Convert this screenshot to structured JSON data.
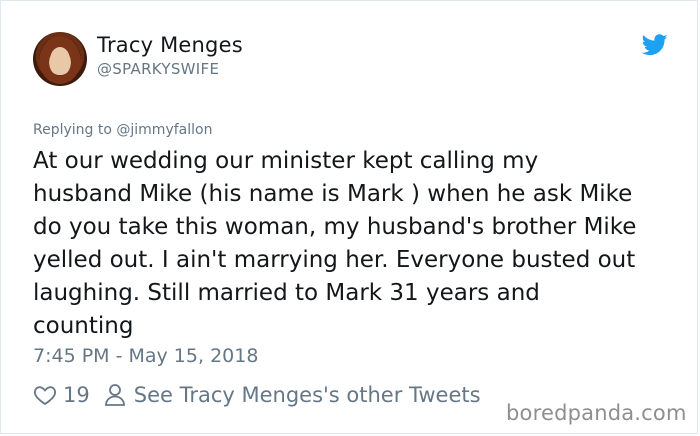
{
  "author": {
    "name": "Tracy Menges",
    "handle": "@SPARKYSWIFE"
  },
  "reply": {
    "prefix": "Replying to ",
    "mention": "@jimmyfallon"
  },
  "tweet": {
    "text": "At our wedding our minister kept calling my\nhusband Mike (his name is Mark ) when he ask Mike\ndo you take this woman, my husband's brother Mike\nyelled out. I ain't marrying her. Everyone busted out\nlaughing. Still married to Mark 31 years and\ncounting",
    "timestamp": "7:45 PM - May 15, 2018"
  },
  "actions": {
    "like_count": "19",
    "other_tweets_label": "See Tracy Menges's other Tweets"
  },
  "watermark": "boredpanda.com",
  "icons": {
    "brand": "twitter-bird-icon",
    "like": "heart-icon",
    "profile": "person-icon"
  },
  "colors": {
    "twitter_blue": "#1da1f2",
    "text_primary": "#14171a",
    "text_secondary": "#657786"
  }
}
